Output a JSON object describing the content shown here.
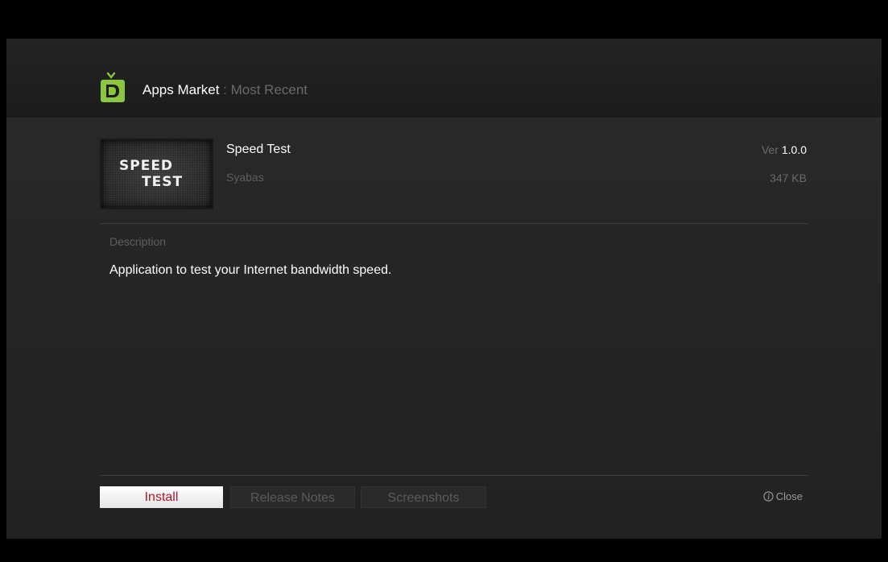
{
  "header": {
    "title": "Apps Market",
    "separator": " : ",
    "subtitle": "Most Recent",
    "logo_icon": "tv-logo-icon",
    "accent_color": "#8cc63f"
  },
  "app": {
    "icon_line1": "SPEED",
    "icon_line2": "TEST",
    "name": "Speed Test",
    "publisher": "Syabas",
    "version_label": "Ver ",
    "version": "1.0.0",
    "size": "347 KB"
  },
  "description": {
    "label": "Description",
    "text": "Application to test your Internet bandwidth speed."
  },
  "buttons": {
    "install": "Install",
    "release_notes": "Release Notes",
    "screenshots": "Screenshots",
    "install_text_color": "#b3142a"
  },
  "close": {
    "label": "Close",
    "icon": "info-circle-icon"
  }
}
